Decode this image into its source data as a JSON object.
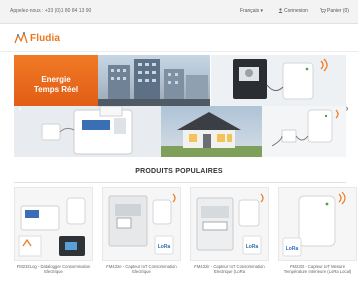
{
  "topbar": {
    "phone": "Appelez-nous : +33 (0)1 80 84 13 90",
    "language": "Français ▾",
    "signin": "Connexion",
    "cart": "Panier (0)"
  },
  "logo": {
    "text": "Fludia"
  },
  "banner": {
    "headline": "Energie Temps Réel",
    "prev_icon": "chevron-left-icon",
    "next_icon": "chevron-right-icon"
  },
  "products_section": {
    "title": "PRODUITS POPULAIRES",
    "items": [
      {
        "name": "FM232Log - Datalogger Consommation Electrique"
      },
      {
        "name": "FM432e - Capteur IoT Consommation Electrique"
      },
      {
        "name": "FM432ir - Capteur IoT Consommation Electrique (LoRa"
      },
      {
        "name": "FM232t - Capteur IoT Mesure Température Intérieure (LoRa Local)"
      }
    ]
  },
  "colors": {
    "brand_orange": "#e8761f",
    "banner_orange": "#f07a24"
  }
}
